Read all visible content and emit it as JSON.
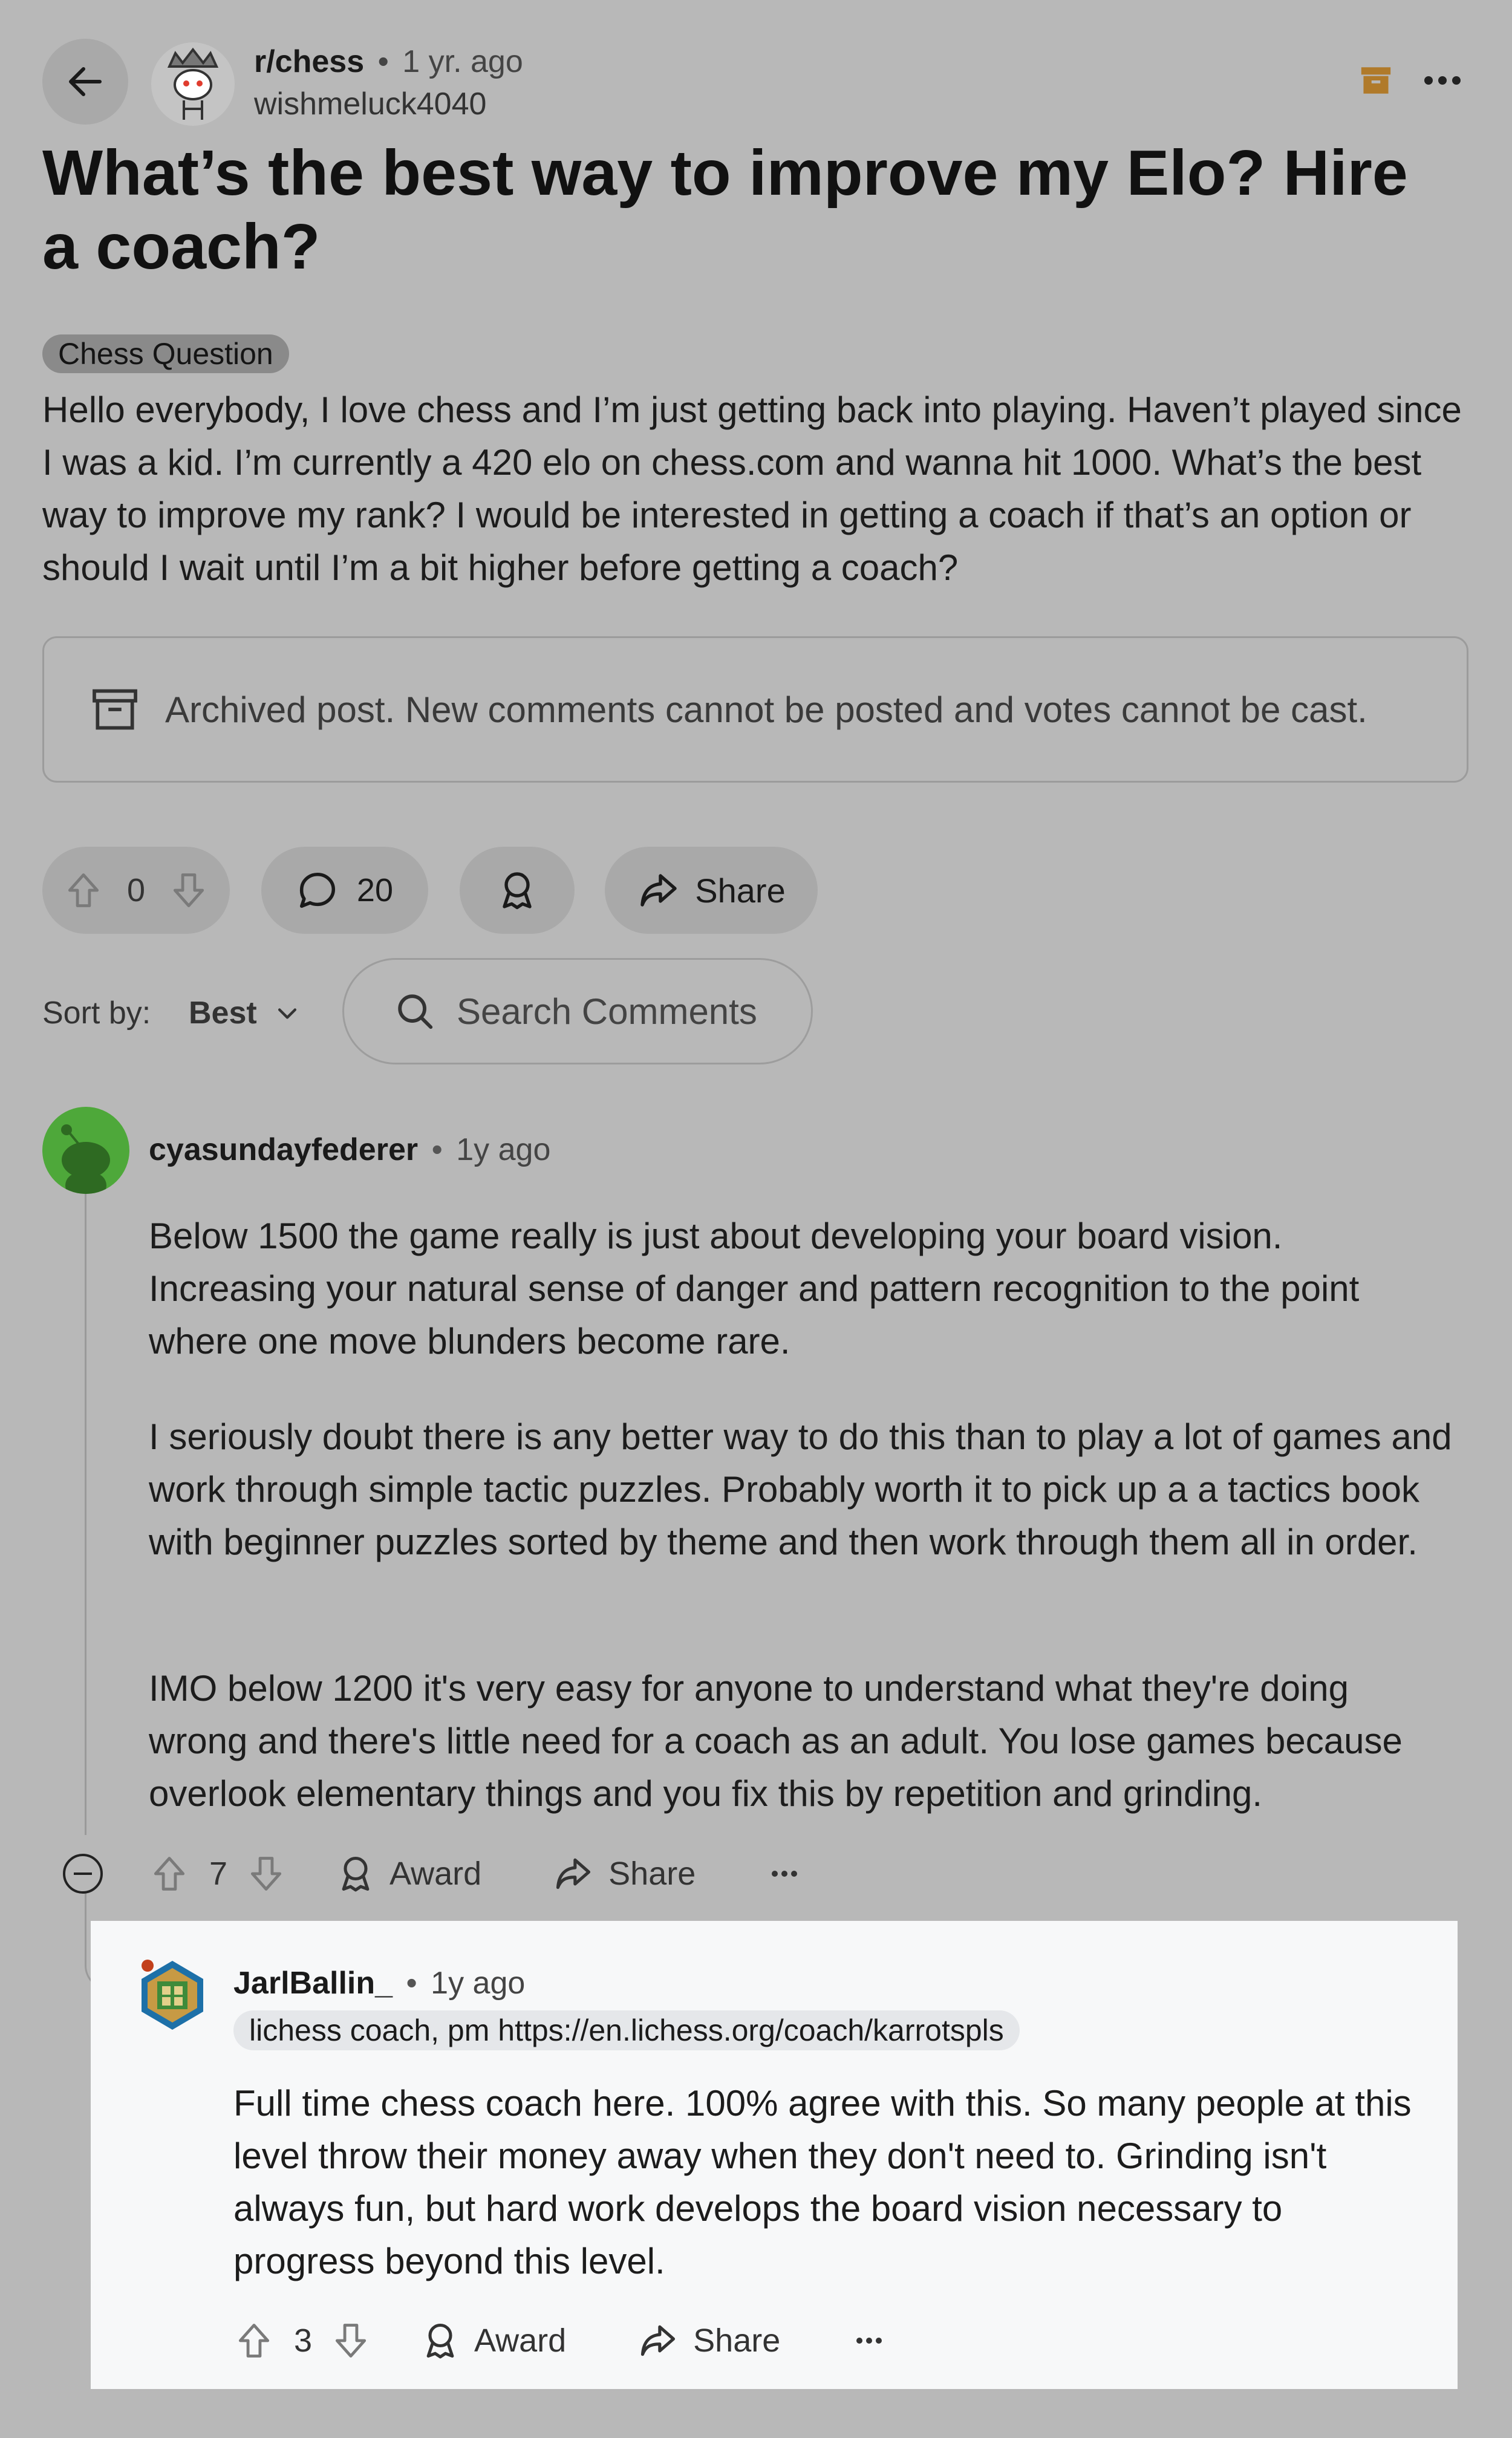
{
  "post": {
    "subreddit": "r/chess",
    "separator": "•",
    "age": "1 yr. ago",
    "author": "wishmeluck4040",
    "title": "What’s the best way to improve my Elo? Hire a coach?",
    "flair": "Chess Question",
    "body": "Hello everybody, I love chess and I’m just getting back into playing. Haven’t played since I was a kid. I’m currently a 420 elo on chess.com and wanna hit 1000. What’s the best way to improve my rank? I would be interested in getting a coach if that’s an option or should I wait until I’m a bit higher before getting a coach?",
    "archived_notice": "Archived post. New comments cannot be posted and votes cannot be cast.",
    "votes": "0",
    "comments": "20",
    "share_label": "Share"
  },
  "sort": {
    "label": "Sort by:",
    "value": "Best"
  },
  "search": {
    "placeholder": "Search Comments"
  },
  "comments": [
    {
      "author": "cyasundayfederer",
      "separator": "•",
      "age": "1y ago",
      "paragraphs": [
        "Below 1500 the game really is just about developing your board vision. Increasing your natural sense of danger and pattern recognition to the point where one move blunders become rare.",
        "I seriously doubt there is any better way to do this than to play a lot of games and work through simple tactic puzzles. Probably worth it to pick up a a tactics book with beginner puzzles sorted by theme and then work through them all in order.",
        "IMO below 1200 it's very easy for anyone to understand what they're doing wrong and there's little need for a coach as an adult. You lose games because overlook elementary things and you fix this by repetition and grinding."
      ],
      "votes": "7",
      "award_label": "Award",
      "share_label": "Share"
    },
    {
      "author": "JarlBallin_",
      "separator": "•",
      "age": "1y ago",
      "flair": "lichess coach, pm https://en.lichess.org/coach/karrotspls",
      "paragraphs": [
        "Full time chess coach here. 100% agree with this. So many people at this level throw their money away when they don't need to. Grinding isn't always fun, but hard work develops the board vision necessary to progress beyond this level."
      ],
      "votes": "3",
      "award_label": "Award",
      "share_label": "Share"
    }
  ],
  "colors": {
    "background": "#b8b8b8",
    "button": "#a9a9a9",
    "reply_card": "#f7f8f9",
    "archive_icon": "#b07a2a"
  }
}
